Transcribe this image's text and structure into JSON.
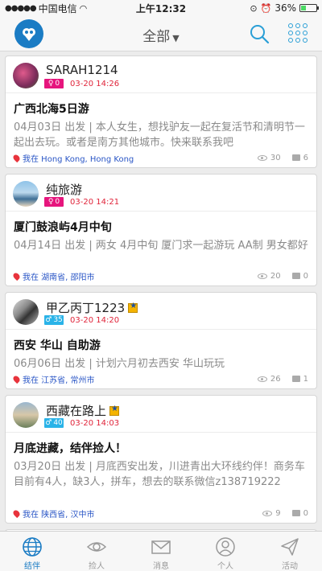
{
  "status_bar": {
    "carrier": "中国电信",
    "time": "上午12:32",
    "battery": "36%",
    "battery_level": 0.36
  },
  "nav": {
    "title": "全部"
  },
  "posts": [
    {
      "name": "SARAH1214",
      "gender": "♀",
      "age": "0",
      "time": "03-20 14:26",
      "vip": false,
      "title": "广西北海5日游",
      "desc": "04月03日 出发 | 本人女生，想找驴友一起在复活节和清明节一起出去玩。或者是南方其他城市。快来联系我吧",
      "location": "我在 Hong Kong, Hong Kong",
      "views": "30",
      "comments": "6"
    },
    {
      "name": "纯旅游",
      "gender": "♀",
      "age": "0",
      "time": "03-20 14:21",
      "vip": false,
      "title": "厦门鼓浪屿4月中旬",
      "desc": "04月14日 出发 | 两女 4月中旬 厦门求一起游玩 AA制 男女都好",
      "location": "我在 湖南省, 邵阳市",
      "views": "20",
      "comments": "0"
    },
    {
      "name": "甲乙丙丁1223",
      "gender": "♂",
      "age": "35",
      "time": "03-20 14:20",
      "vip": true,
      "title": "西安 华山 自助游",
      "desc": "06月06日 出发 | 计划六月初去西安 华山玩玩",
      "location": "我在 江苏省, 常州市",
      "views": "26",
      "comments": "1"
    },
    {
      "name": "西藏在路上",
      "gender": "♂",
      "age": "40",
      "time": "03-20 14:03",
      "vip": true,
      "title": "月底进藏，结伴捡人！",
      "desc": "03月20日 出发 | 月底西安出发，川进青出大环线约伴！商务车目前有4人，缺3人，拼车，想去的联系微信z138719222",
      "location": "我在 陕西省, 汉中市",
      "views": "9",
      "comments": "0"
    }
  ],
  "tabs": [
    {
      "label": "结伴",
      "icon": "globe-icon",
      "active": true
    },
    {
      "label": "捡人",
      "icon": "eye-icon",
      "active": false
    },
    {
      "label": "消息",
      "icon": "envelope-icon",
      "active": false
    },
    {
      "label": "个人",
      "icon": "person-icon",
      "active": false
    },
    {
      "label": "活动",
      "icon": "paper-plane-icon",
      "active": false
    }
  ],
  "colors": {
    "accent": "#1b7cc4",
    "female": "#e6157d",
    "male": "#2ab3e8",
    "time": "#e0243a",
    "location": "#2a56c6"
  }
}
